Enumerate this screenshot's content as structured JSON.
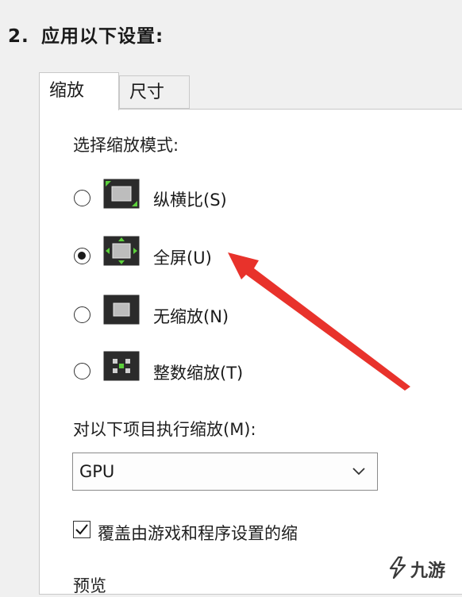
{
  "heading": {
    "number": "2.",
    "text": "应用以下设置:"
  },
  "tabs": [
    {
      "label": "缩放",
      "active": true
    },
    {
      "label": "尺寸",
      "active": false
    }
  ],
  "scaling_mode": {
    "label": "选择缩放模式:",
    "options": [
      {
        "label": "纵横比(S)",
        "icon": "aspect-ratio-icon",
        "selected": false
      },
      {
        "label": "全屏(U)",
        "icon": "full-screen-icon",
        "selected": true
      },
      {
        "label": "无缩放(N)",
        "icon": "no-scaling-icon",
        "selected": false
      },
      {
        "label": "整数缩放(T)",
        "icon": "integer-scaling-icon",
        "selected": false
      }
    ]
  },
  "perform_scaling": {
    "label": "对以下项目执行缩放(M):",
    "selected": "GPU"
  },
  "override": {
    "label": "覆盖由游戏和程序设置的缩",
    "checked": true
  },
  "preview": {
    "label": "预览"
  },
  "watermark": {
    "text": "九游"
  },
  "colors": {
    "arrow": "#e8322b",
    "accent_green": "#5bd13b"
  }
}
